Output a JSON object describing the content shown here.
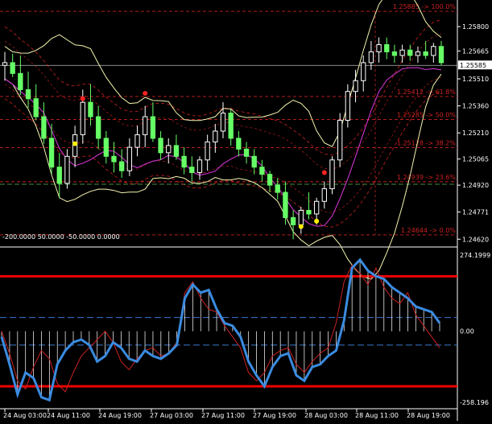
{
  "chart_data": [
    {
      "type": "candlestick",
      "price_axis": {
        "ticks": [
          "1.25800",
          "1.25665",
          "1.25510",
          "1.25360",
          "1.25210",
          "1.25065",
          "1.24920",
          "1.24771",
          "1.24620"
        ],
        "current_price": "1.25585"
      },
      "fibonacci_levels": [
        {
          "label": "1.25885 -> 100.0%"
        },
        {
          "label": "1.25412 -> 61.8%"
        },
        {
          "label": "1.25285 -> 50.0%"
        },
        {
          "label": "1.25128 -> 38.2%"
        },
        {
          "label": "1.24939 -> 23.6%"
        },
        {
          "label": "1.24644 -> 0.0%"
        }
      ],
      "candles": [
        {
          "o": 1.25585,
          "h": 1.2566,
          "l": 1.255,
          "c": 1.256
        },
        {
          "o": 1.256,
          "h": 1.2565,
          "l": 1.2552,
          "c": 1.2554
        },
        {
          "o": 1.2554,
          "h": 1.2564,
          "l": 1.2542,
          "c": 1.2545
        },
        {
          "o": 1.2545,
          "h": 1.2555,
          "l": 1.2535,
          "c": 1.254
        },
        {
          "o": 1.254,
          "h": 1.2548,
          "l": 1.2528,
          "c": 1.253
        },
        {
          "o": 1.253,
          "h": 1.2538,
          "l": 1.2515,
          "c": 1.2518
        },
        {
          "o": 1.2518,
          "h": 1.2526,
          "l": 1.2498,
          "c": 1.2502
        },
        {
          "o": 1.2502,
          "h": 1.251,
          "l": 1.2485,
          "c": 1.2493
        },
        {
          "o": 1.2493,
          "h": 1.2512,
          "l": 1.249,
          "c": 1.2508
        },
        {
          "o": 1.2508,
          "h": 1.2525,
          "l": 1.2502,
          "c": 1.252
        },
        {
          "o": 1.252,
          "h": 1.2545,
          "l": 1.2515,
          "c": 1.2538
        },
        {
          "o": 1.2538,
          "h": 1.2548,
          "l": 1.2525,
          "c": 1.253
        },
        {
          "o": 1.253,
          "h": 1.2536,
          "l": 1.2512,
          "c": 1.2518
        },
        {
          "o": 1.2518,
          "h": 1.2522,
          "l": 1.2504,
          "c": 1.2508
        },
        {
          "o": 1.2508,
          "h": 1.2516,
          "l": 1.2499,
          "c": 1.2505
        },
        {
          "o": 1.2505,
          "h": 1.2512,
          "l": 1.2496,
          "c": 1.25
        },
        {
          "o": 1.25,
          "h": 1.2518,
          "l": 1.2497,
          "c": 1.2513
        },
        {
          "o": 1.2513,
          "h": 1.2525,
          "l": 1.2508,
          "c": 1.252
        },
        {
          "o": 1.252,
          "h": 1.2536,
          "l": 1.2513,
          "c": 1.253
        },
        {
          "o": 1.253,
          "h": 1.2538,
          "l": 1.2516,
          "c": 1.2518
        },
        {
          "o": 1.2518,
          "h": 1.2522,
          "l": 1.2506,
          "c": 1.251
        },
        {
          "o": 1.251,
          "h": 1.2518,
          "l": 1.2504,
          "c": 1.2514
        },
        {
          "o": 1.2514,
          "h": 1.252,
          "l": 1.2506,
          "c": 1.2508
        },
        {
          "o": 1.2508,
          "h": 1.2513,
          "l": 1.2498,
          "c": 1.2502
        },
        {
          "o": 1.2502,
          "h": 1.2508,
          "l": 1.2494,
          "c": 1.2499
        },
        {
          "o": 1.2499,
          "h": 1.2508,
          "l": 1.2495,
          "c": 1.2506
        },
        {
          "o": 1.2506,
          "h": 1.252,
          "l": 1.25,
          "c": 1.2516
        },
        {
          "o": 1.2516,
          "h": 1.2526,
          "l": 1.251,
          "c": 1.2522
        },
        {
          "o": 1.2522,
          "h": 1.2538,
          "l": 1.2518,
          "c": 1.2532
        },
        {
          "o": 1.2532,
          "h": 1.2534,
          "l": 1.2514,
          "c": 1.2518
        },
        {
          "o": 1.2518,
          "h": 1.2522,
          "l": 1.2508,
          "c": 1.2512
        },
        {
          "o": 1.2512,
          "h": 1.2516,
          "l": 1.2504,
          "c": 1.2508
        },
        {
          "o": 1.2508,
          "h": 1.2512,
          "l": 1.2498,
          "c": 1.2502
        },
        {
          "o": 1.2502,
          "h": 1.2506,
          "l": 1.2494,
          "c": 1.2498
        },
        {
          "o": 1.2498,
          "h": 1.25,
          "l": 1.2488,
          "c": 1.2492
        },
        {
          "o": 1.2492,
          "h": 1.2496,
          "l": 1.2484,
          "c": 1.2488
        },
        {
          "o": 1.2488,
          "h": 1.2494,
          "l": 1.247,
          "c": 1.2474
        },
        {
          "o": 1.2474,
          "h": 1.2478,
          "l": 1.2462,
          "c": 1.247
        },
        {
          "o": 1.247,
          "h": 1.248,
          "l": 1.2465,
          "c": 1.2478
        },
        {
          "o": 1.2478,
          "h": 1.2488,
          "l": 1.2473,
          "c": 1.2476
        },
        {
          "o": 1.2476,
          "h": 1.2485,
          "l": 1.247,
          "c": 1.2483
        },
        {
          "o": 1.2483,
          "h": 1.2494,
          "l": 1.2479,
          "c": 1.249
        },
        {
          "o": 1.249,
          "h": 1.2508,
          "l": 1.2487,
          "c": 1.2506
        },
        {
          "o": 1.2506,
          "h": 1.2532,
          "l": 1.2502,
          "c": 1.2528
        },
        {
          "o": 1.2528,
          "h": 1.2548,
          "l": 1.2524,
          "c": 1.2544
        },
        {
          "o": 1.2544,
          "h": 1.2556,
          "l": 1.2538,
          "c": 1.255
        },
        {
          "o": 1.255,
          "h": 1.2564,
          "l": 1.2544,
          "c": 1.256
        },
        {
          "o": 1.256,
          "h": 1.2572,
          "l": 1.2556,
          "c": 1.2566
        },
        {
          "o": 1.2566,
          "h": 1.2574,
          "l": 1.256,
          "c": 1.257
        },
        {
          "o": 1.257,
          "h": 1.2574,
          "l": 1.2562,
          "c": 1.2566
        },
        {
          "o": 1.2566,
          "h": 1.257,
          "l": 1.256,
          "c": 1.2564
        },
        {
          "o": 1.2564,
          "h": 1.257,
          "l": 1.256,
          "c": 1.2567
        },
        {
          "o": 1.2567,
          "h": 1.257,
          "l": 1.2561,
          "c": 1.2564
        },
        {
          "o": 1.2564,
          "h": 1.2569,
          "l": 1.256,
          "c": 1.2566
        },
        {
          "o": 1.2566,
          "h": 1.2572,
          "l": 1.2562,
          "c": 1.2564
        },
        {
          "o": 1.2564,
          "h": 1.2571,
          "l": 1.256,
          "c": 1.2569
        },
        {
          "o": 1.2569,
          "h": 1.2572,
          "l": 1.25585,
          "c": 1.256
        }
      ],
      "colors": {
        "bull": "#ffffff",
        "bear": "#66ff66",
        "fib": "#cc2222",
        "bands": "#f5f5b0",
        "envelope": "#cc2222",
        "ma": "#cc33cc",
        "marker_red": "#ff2222",
        "marker_yellow": "#ffee00"
      }
    },
    {
      "type": "oscillator",
      "header": "-200.0000 50.0000 -50.0000 0.0000",
      "axis_labels": {
        "top": "274.1999",
        "zero": "0.00",
        "bottom": "-258.196"
      },
      "levels": {
        "upper": 200,
        "mid_up": 50,
        "zero": 0,
        "mid_down": -50,
        "lower": -200
      },
      "cci_blue": [
        -20,
        -120,
        -230,
        -150,
        -170,
        -240,
        -250,
        -120,
        -70,
        -40,
        -30,
        -50,
        -110,
        -90,
        -40,
        -60,
        -100,
        -110,
        -70,
        -90,
        -100,
        -80,
        -50,
        120,
        170,
        140,
        150,
        80,
        30,
        20,
        -20,
        -110,
        -160,
        -200,
        -130,
        -90,
        -80,
        -160,
        -180,
        -130,
        -120,
        -90,
        -70,
        40,
        230,
        260,
        220,
        200,
        190,
        160,
        140,
        120,
        90,
        80,
        70,
        30
      ],
      "cci_red": [
        0,
        -80,
        -180,
        -210,
        -130,
        -70,
        -100,
        -190,
        -220,
        -150,
        -90,
        -60,
        -30,
        0,
        -40,
        -110,
        -140,
        -100,
        -70,
        -60,
        -90,
        -80,
        -40,
        140,
        180,
        120,
        80,
        70,
        20,
        -20,
        -60,
        -150,
        -180,
        -150,
        -90,
        -70,
        -60,
        -120,
        -150,
        -110,
        -80,
        -60,
        30,
        180,
        240,
        210,
        170,
        230,
        160,
        120,
        100,
        140,
        60,
        20,
        -20,
        -60
      ],
      "x_tick_labels": [
        "24 Aug 03:00",
        "24 Aug 11:00",
        "24 Aug 19:00",
        "27 Aug 03:00",
        "27 Aug 11:00",
        "27 Aug 19:00",
        "28 Aug 03:00",
        "28 Aug 11:00",
        "28 Aug 19:00"
      ],
      "colors": {
        "blue": "#3a8be0",
        "red": "#cc2222",
        "level_red": "#ee0000",
        "level_blue": "#3a7ad0"
      }
    }
  ]
}
